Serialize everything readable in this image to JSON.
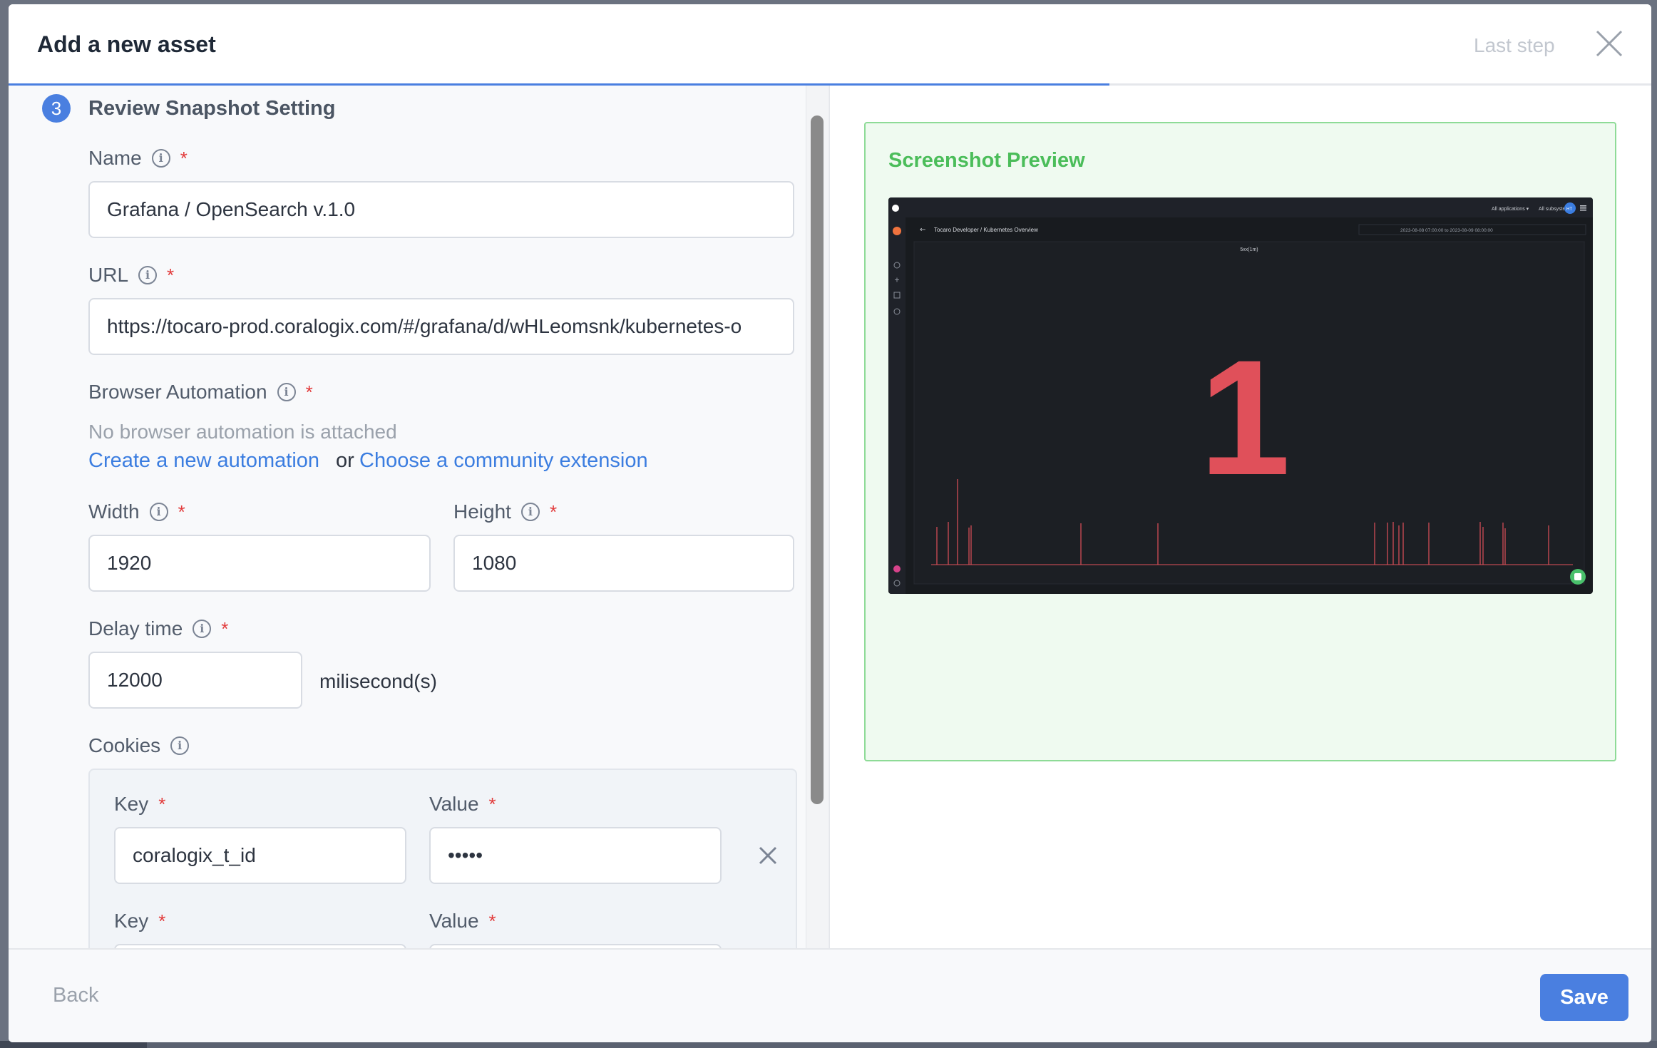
{
  "header": {
    "title": "Add a new asset",
    "last_step_label": "Last step",
    "progress_fraction": 0.67
  },
  "step": {
    "number": "3",
    "title": "Review Snapshot Setting"
  },
  "form": {
    "name": {
      "label": "Name",
      "required_mark": "*",
      "value": "Grafana / OpenSearch v.1.0"
    },
    "url": {
      "label": "URL",
      "required_mark": "*",
      "value": "https://tocaro-prod.coralogix.com/#/grafana/d/wHLeomsnk/kubernetes-o"
    },
    "browser_automation": {
      "label": "Browser Automation",
      "required_mark": "*",
      "status_text": "No browser automation is attached",
      "create_link": "Create a new automation",
      "or_text": "or",
      "community_link": "Choose a community extension"
    },
    "width": {
      "label": "Width",
      "required_mark": "*",
      "value": "1920"
    },
    "height": {
      "label": "Height",
      "required_mark": "*",
      "value": "1080"
    },
    "delay": {
      "label": "Delay time",
      "required_mark": "*",
      "value": "12000",
      "unit": "milisecond(s)"
    },
    "cookies": {
      "label": "Cookies",
      "rows": [
        {
          "key_label": "Key",
          "value_label": "Value",
          "required_mark": "*",
          "key": "coralogix_t_id",
          "value": "•••••"
        },
        {
          "key_label": "Key",
          "value_label": "Value",
          "required_mark": "*",
          "key": "",
          "value": ""
        }
      ]
    }
  },
  "preview": {
    "title": "Screenshot Preview",
    "topbar": {
      "apps_label": "All applications ▾",
      "subsystems_label": "All subsystems ▾",
      "avatar_initials": "HT"
    },
    "breadcrumb": "Tocaro Developer / Kubernetes Overview",
    "time_range": "2023-08-08 07:00:00 to 2023-08-09 08:00:00",
    "panel_title": "5xx(1m)",
    "big_stat": "1",
    "colors": {
      "stat": "#e0505a",
      "background": "#181b1f"
    }
  },
  "footer": {
    "back_label": "Back",
    "save_label": "Save"
  }
}
